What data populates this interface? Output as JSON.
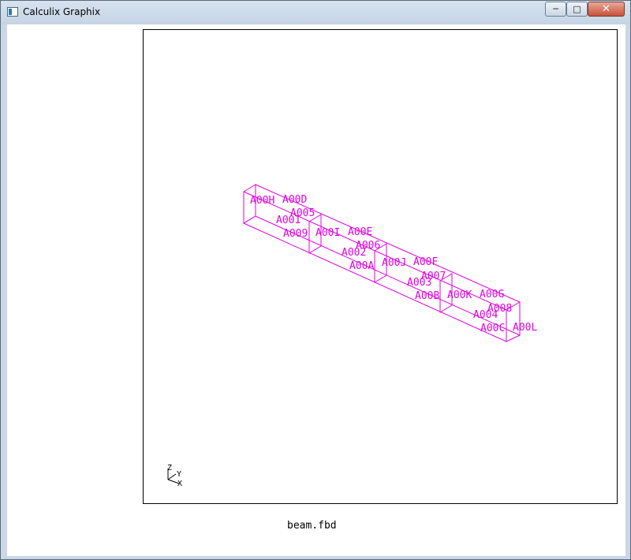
{
  "window": {
    "title": "Calculix Graphix",
    "controls": {
      "minimize": "─",
      "maximize": "□",
      "close": "✕"
    }
  },
  "viewport": {
    "line_color": "#e000e0",
    "labels": [
      "A00H",
      "A00D",
      "A005",
      "A001",
      "A009",
      "A00I",
      "A00E",
      "A006",
      "A002",
      "A00A",
      "A00J",
      "A00F",
      "A007",
      "A003",
      "A00B",
      "A00K",
      "A00G",
      "A008",
      "A004",
      "A00C",
      "A00L"
    ],
    "axes": {
      "z": "Z",
      "y": "Y",
      "x": "X"
    }
  },
  "status": {
    "filename": "beam.fbd"
  }
}
